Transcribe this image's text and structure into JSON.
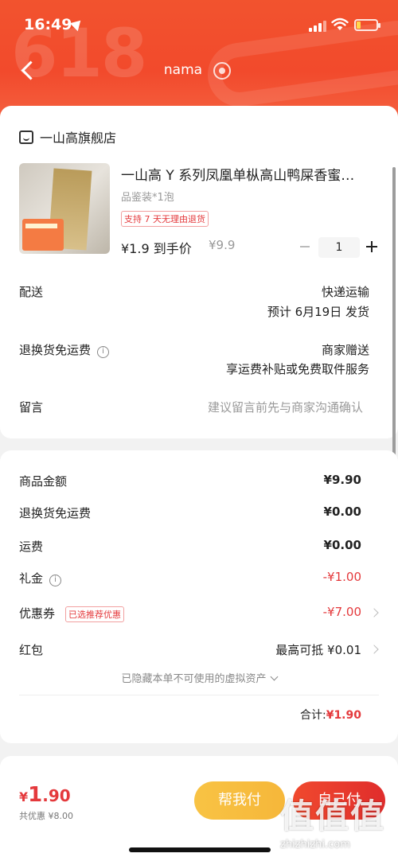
{
  "status_bar": {
    "time": "16:49"
  },
  "header": {
    "title": "nama",
    "bg_color": "#f2532e"
  },
  "shop": {
    "name": "一山高旗舰店"
  },
  "product": {
    "title": "一山高 Y 系列凤凰单枞高山鸭屎香蜜…",
    "spec": "品鉴装*1泡",
    "badge": "支持 7 天无理由退货",
    "price": "¥1.9 到手价",
    "original_price": "¥9.9",
    "quantity": "1"
  },
  "delivery": {
    "label": "配送",
    "method": "快递运输",
    "eta": "预计 6月19日 发货"
  },
  "return_shipping": {
    "label": "退换货免运费",
    "value_line1": "商家赠送",
    "value_line2": "享运费补贴或免费取件服务"
  },
  "note": {
    "label": "留言",
    "placeholder": "建议留言前先与商家沟通确认"
  },
  "summary": {
    "goods_amount": {
      "label": "商品金额",
      "value": "¥9.90"
    },
    "return_fee": {
      "label": "退换货免运费",
      "value": "¥0.00"
    },
    "shipping": {
      "label": "运费",
      "value": "¥0.00"
    },
    "gift": {
      "label": "礼金",
      "value": "-¥1.00"
    },
    "coupon": {
      "label": "优惠券",
      "badge": "已选推荐优惠",
      "value": "-¥7.00"
    },
    "redpacket": {
      "label": "红包",
      "value": "最高可抵 ¥0.01"
    },
    "hidden_note": "已隐藏本单不可使用的虚拟资产",
    "total_label": "合计:",
    "total_value": "¥1.90"
  },
  "footer": {
    "currency": "¥",
    "price_int": "1",
    "price_dec": ".90",
    "saved": "共优惠 ¥8.00",
    "help_pay": "帮我付",
    "self_pay": "自己付"
  },
  "watermark": {
    "cn": "值值值",
    "en": "zhizhizhi.com"
  },
  "colors": {
    "accent": "#e4393c",
    "help_btn": "#f8c344",
    "pay_btn": "#e02d2c"
  }
}
